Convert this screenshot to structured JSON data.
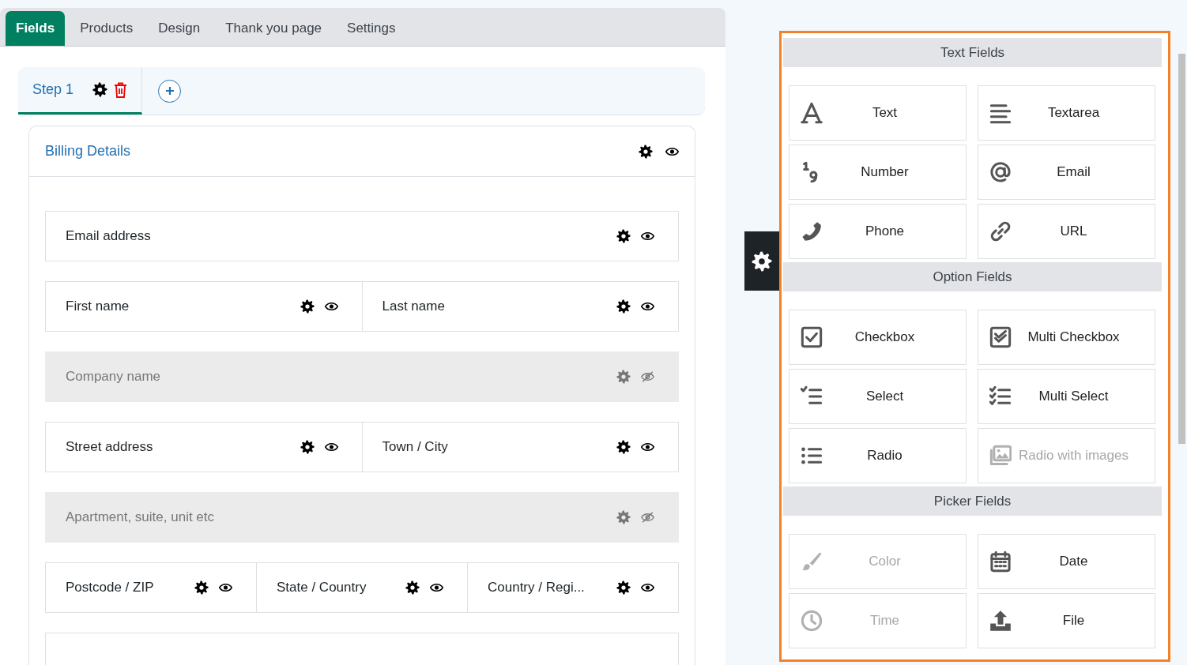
{
  "tabs": [
    {
      "label": "Fields",
      "selected": true
    },
    {
      "label": "Products",
      "selected": false
    },
    {
      "label": "Design",
      "selected": false
    },
    {
      "label": "Thank you page",
      "selected": false
    },
    {
      "label": "Settings",
      "selected": false
    }
  ],
  "steps": [
    {
      "label": "Step 1",
      "selected": true
    }
  ],
  "section": {
    "title": "Billing Details",
    "visible": true
  },
  "rows": [
    {
      "fields": [
        {
          "label": "Email address",
          "visible": true
        }
      ]
    },
    {
      "fields": [
        {
          "label": "First name",
          "visible": true
        },
        {
          "label": "Last name",
          "visible": true
        }
      ]
    },
    {
      "fields": [
        {
          "label": "Company name",
          "visible": false
        }
      ]
    },
    {
      "fields": [
        {
          "label": "Street address",
          "visible": true
        },
        {
          "label": "Town / City",
          "visible": true
        }
      ]
    },
    {
      "fields": [
        {
          "label": "Apartment, suite, unit etc",
          "visible": false
        }
      ]
    },
    {
      "fields": [
        {
          "label": "Postcode / ZIP",
          "visible": true
        },
        {
          "label": "State / Country",
          "visible": true
        },
        {
          "label": "Country / Regi...",
          "visible": true
        }
      ]
    }
  ],
  "palette": [
    {
      "title": "Text Fields",
      "items": [
        {
          "label": "Text",
          "kind": "text",
          "disabled": false
        },
        {
          "label": "Textarea",
          "kind": "textarea",
          "disabled": false
        },
        {
          "label": "Number",
          "kind": "number",
          "disabled": false
        },
        {
          "label": "Email",
          "kind": "email",
          "disabled": false
        },
        {
          "label": "Phone",
          "kind": "phone",
          "disabled": false
        },
        {
          "label": "URL",
          "kind": "url",
          "disabled": false
        }
      ]
    },
    {
      "title": "Option Fields",
      "items": [
        {
          "label": "Checkbox",
          "kind": "checkbox",
          "disabled": false
        },
        {
          "label": "Multi Checkbox",
          "kind": "multicheckbox",
          "disabled": false
        },
        {
          "label": "Select",
          "kind": "select",
          "disabled": false
        },
        {
          "label": "Multi Select",
          "kind": "multiselect",
          "disabled": false
        },
        {
          "label": "Radio",
          "kind": "radio",
          "disabled": false
        },
        {
          "label": "Radio with images",
          "kind": "radioimages",
          "disabled": true
        }
      ]
    },
    {
      "title": "Picker Fields",
      "items": [
        {
          "label": "Color",
          "kind": "color",
          "disabled": true
        },
        {
          "label": "Date",
          "kind": "date",
          "disabled": false
        },
        {
          "label": "Time",
          "kind": "time",
          "disabled": true
        },
        {
          "label": "File",
          "kind": "file",
          "disabled": false
        }
      ]
    }
  ]
}
